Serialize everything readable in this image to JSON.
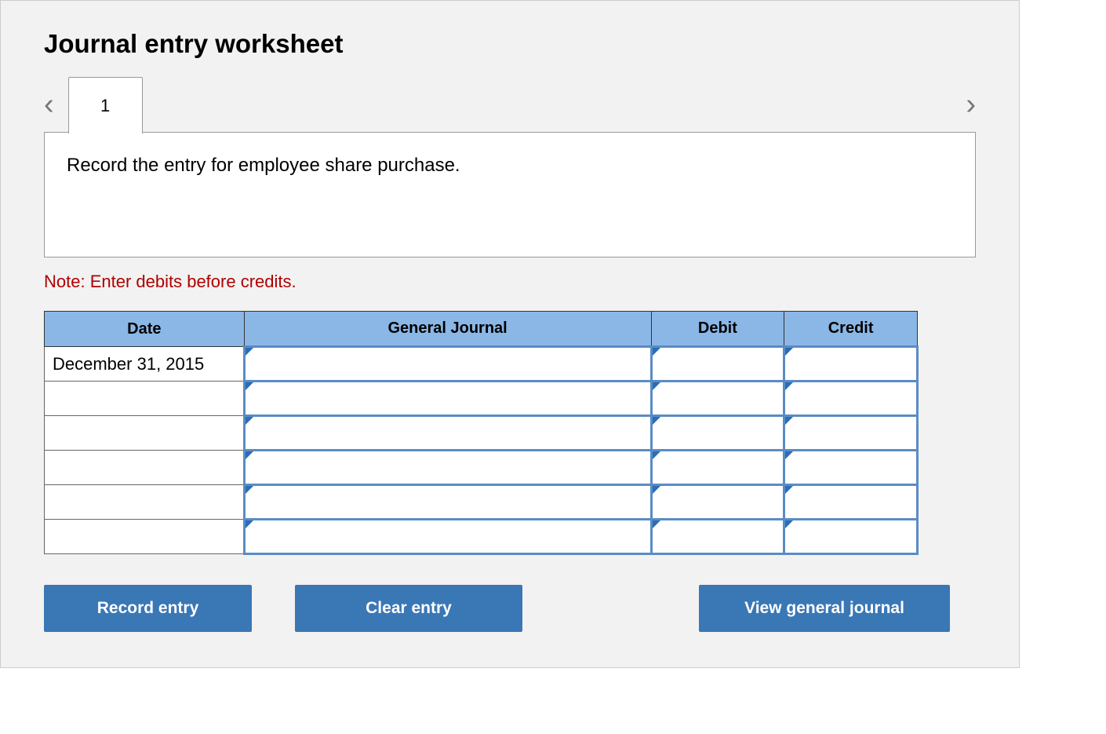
{
  "title": "Journal entry worksheet",
  "tab_label": "1",
  "instruction": "Record the entry for employee share purchase.",
  "note": "Note: Enter debits before credits.",
  "columns": {
    "date": "Date",
    "general_journal": "General Journal",
    "debit": "Debit",
    "credit": "Credit"
  },
  "rows": [
    {
      "date": "December 31, 2015",
      "gj": "",
      "debit": "",
      "credit": ""
    },
    {
      "date": "",
      "gj": "",
      "debit": "",
      "credit": ""
    },
    {
      "date": "",
      "gj": "",
      "debit": "",
      "credit": ""
    },
    {
      "date": "",
      "gj": "",
      "debit": "",
      "credit": ""
    },
    {
      "date": "",
      "gj": "",
      "debit": "",
      "credit": ""
    },
    {
      "date": "",
      "gj": "",
      "debit": "",
      "credit": ""
    }
  ],
  "buttons": {
    "record": "Record entry",
    "clear": "Clear entry",
    "view": "View general journal"
  }
}
